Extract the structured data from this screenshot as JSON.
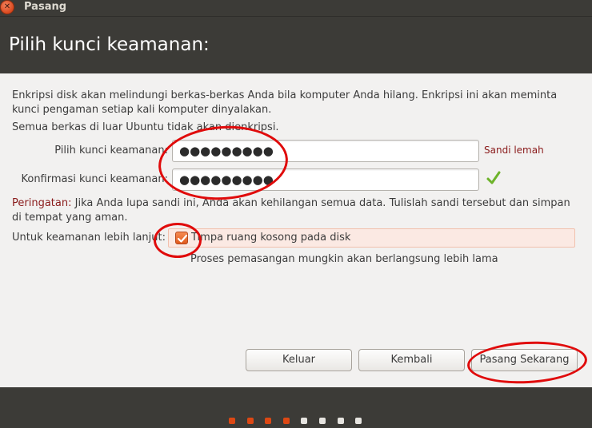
{
  "window": {
    "title": "Pasang",
    "close_glyph": "✕"
  },
  "header": {
    "title": "Pilih kunci keamanan:"
  },
  "content": {
    "intro": "Enkripsi disk akan melindungi berkas-berkas Anda bila komputer Anda hilang. Enkripsi ini akan meminta kunci pengaman setiap kali komputer dinyalakan.",
    "note": "Semua berkas di luar Ubuntu tidak akan dienkripsi.",
    "key_label": "Pilih kunci keamanan:",
    "key_value": "●●●●●●●●●",
    "strength": "Sandi lemah",
    "confirm_label": "Konfirmasi kunci keamanan:",
    "confirm_value": "●●●●●●●●●",
    "warning_prefix": "Peringatan:",
    "warning_text": " Jika Anda lupa sandi ini, Anda akan kehilangan semua data. Tulislah sandi tersebut dan simpan di tempat yang aman.",
    "extra_label": "Untuk keamanan lebih lanjut:",
    "overwrite_label": "Timpa ruang kosong pada disk",
    "overwrite_checked": true,
    "overwrite_note": "Proses pemasangan mungkin akan berlangsung lebih lama"
  },
  "buttons": {
    "quit": "Keluar",
    "back": "Kembali",
    "install": "Pasang Sekarang"
  },
  "progress": {
    "total_steps": 8,
    "completed_steps": 4
  },
  "colors": {
    "accent": "#dd4814",
    "warning": "#8a1b1b",
    "annotation": "#e00b0b"
  }
}
